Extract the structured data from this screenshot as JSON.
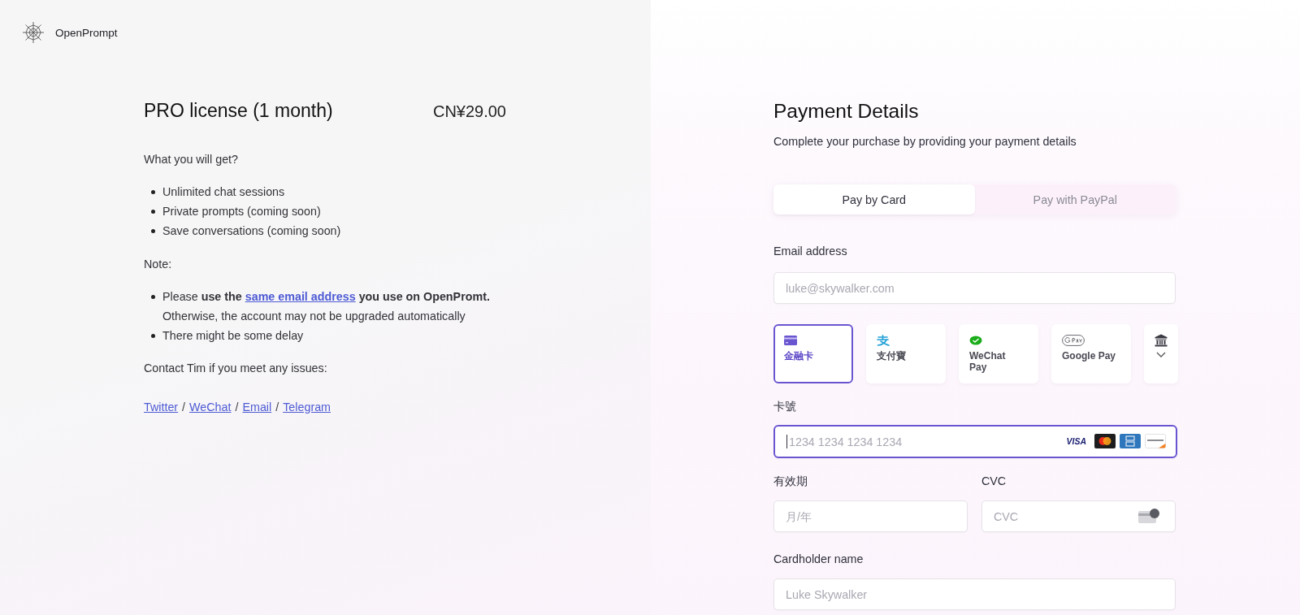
{
  "brand": {
    "name": "OpenPrompt"
  },
  "product": {
    "title": "PRO license (1 month)",
    "price": "CN¥29.00"
  },
  "benefits": {
    "heading": "What you will get?",
    "items": [
      "Unlimited chat sessions",
      "Private prompts (coming soon)",
      "Save conversations (coming soon)"
    ]
  },
  "notes": {
    "heading": "Note:",
    "items": [
      {
        "kind": "link",
        "before": "Please **use the**",
        "link": "same email address",
        "after": "**you use on OpenPromt.** Otherwise, the account may not be upgraded automatically"
      },
      {
        "kind": "text",
        "text": "There might be some delay"
      }
    ]
  },
  "contact": {
    "text": "Contact Tim if you meet any issues:",
    "links": [
      {
        "label": "Twitter"
      },
      {
        "separator": "/",
        "label": "WeChat"
      },
      {
        "separator": "/",
        "label": "Email"
      },
      {
        "separator": "/",
        "label": "Telegram"
      }
    ]
  },
  "payment": {
    "title": "Payment Details",
    "subtitle": "Complete your purchase by providing your payment details",
    "tabs": [
      {
        "label": "Pay by Card",
        "selected": true
      },
      {
        "label": "Pay with PayPal",
        "selected": false
      }
    ],
    "email": {
      "label": "Email address",
      "placeholder": "luke@skywalker.com"
    },
    "methods": [
      {
        "kind": "card",
        "label": "金融卡",
        "selected": true
      },
      {
        "kind": "alipay",
        "label": "支付寶",
        "selected": false
      },
      {
        "kind": "wechat",
        "label": "WeChat Pay",
        "selected": false
      },
      {
        "kind": "googlepay",
        "label": "Google Pay",
        "selected": false
      },
      {
        "kind": "more",
        "selected": false
      }
    ],
    "card_number": {
      "label": "卡號",
      "placeholder": "1234 1234 1234 1234",
      "focused": true,
      "brands": [
        {
          "kind": "visa",
          "label": "VISA"
        },
        {
          "kind": "mastercard"
        },
        {
          "kind": "amex"
        },
        {
          "kind": "discover"
        }
      ]
    },
    "expiry": {
      "label": "有效期",
      "placeholder": "月/年"
    },
    "cvc": {
      "label": "CVC",
      "placeholder": "CVC"
    },
    "cardholder": {
      "label": "Cardholder name",
      "placeholder": "Luke Skywalker"
    }
  }
}
